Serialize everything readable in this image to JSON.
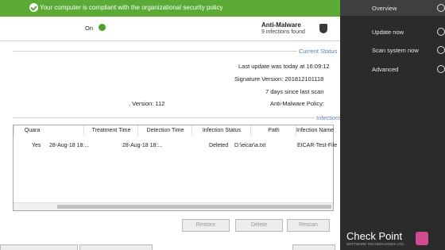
{
  "banner": {
    "text": "Your computer is compliant with the organizational security policy"
  },
  "anti_malware": {
    "title": "Anti-Malware",
    "subtitle": "9 infections found",
    "status": "On"
  },
  "current_status": {
    "label": "Current Status",
    "last_update": "Last update was today at 16:09:12",
    "signature_version": "Signature Version: 201812101118",
    "last_scan": "7 days since last scan",
    "policy_label": "Anti-Malware Policy:",
    "policy_value": ", Version: 112"
  },
  "infections": {
    "label": "Infections",
    "columns": [
      "Infection Name",
      "Path",
      "Infection Status",
      "Detection Time",
      "Treatment Time",
      "Quara"
    ],
    "rows": [
      [
        "EICAR-Test-File",
        "D:\\eicar\\a.txt",
        "Deleted",
        "28-Aug-18 18:...",
        "28-Aug-18 18:...",
        "Yes"
      ]
    ]
  },
  "buttons": {
    "rescan": "Rescan",
    "delete": "Delete",
    "restore": "Restore"
  },
  "sidebar": {
    "items": [
      {
        "label": "Overview",
        "icon": "home-icon",
        "active": true
      },
      {
        "label": "Update now",
        "icon": "refresh-icon",
        "active": false
      },
      {
        "label": "Scan system now",
        "icon": "search-icon",
        "active": false
      },
      {
        "label": "Advanced",
        "icon": "gear-icon",
        "active": false
      }
    ],
    "logo_text": "Check Point",
    "logo_sub": "SOFTWARE TECHNOLOGIES LTD."
  },
  "colors": {
    "banner": "#5aaa35",
    "sidebar": "#2b2b2b",
    "accent": "#5b7fb5",
    "logo": "#d34a8e"
  }
}
